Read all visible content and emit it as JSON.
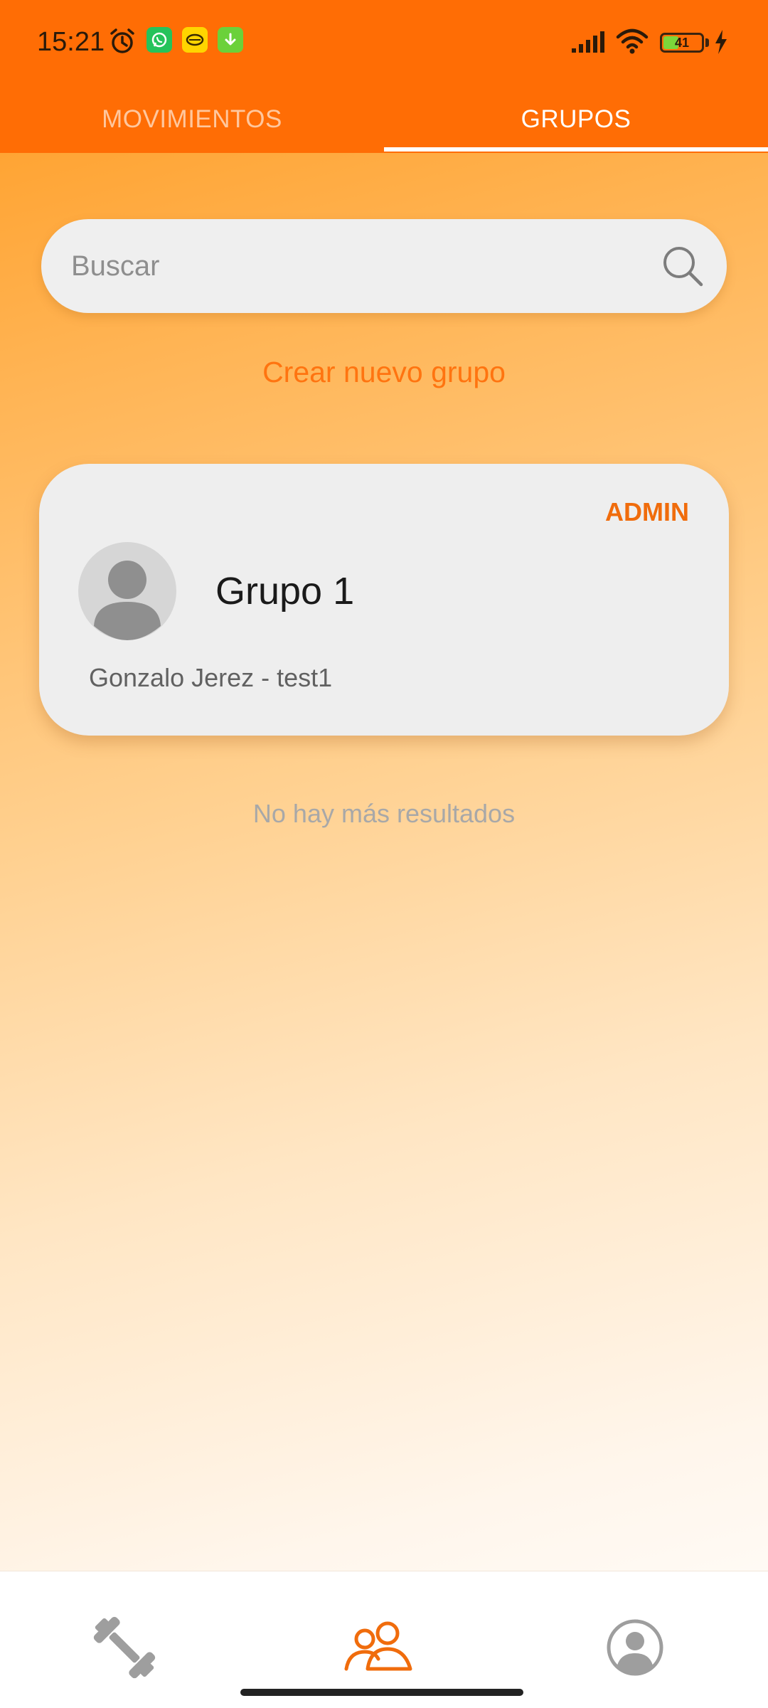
{
  "status_bar": {
    "time": "15:21",
    "battery_level": "41",
    "battery_fraction": 0.41,
    "icons": [
      "alarm-icon",
      "whatsapp-icon",
      "lemon-icon",
      "download-icon",
      "signal-icon",
      "wifi-icon",
      "battery-icon",
      "charging-bolt-icon"
    ]
  },
  "tabs": [
    {
      "label": "MOVIMIENTOS",
      "selected": false
    },
    {
      "label": "GRUPOS",
      "selected": true
    }
  ],
  "search": {
    "placeholder": "Buscar",
    "value": ""
  },
  "create_group_label": "Crear nuevo grupo",
  "groups": [
    {
      "name": "Grupo 1",
      "role": "ADMIN",
      "members": "Gonzalo Jerez - test1",
      "avatar_icon": "person-avatar-icon"
    }
  ],
  "no_more_results": "No hay más resultados",
  "bottom_nav": {
    "items": [
      {
        "icon": "dumbbell-icon",
        "active": false
      },
      {
        "icon": "groups-icon",
        "active": true
      },
      {
        "icon": "profile-icon",
        "active": false
      }
    ]
  },
  "colors": {
    "header": "#ff6d05",
    "accent": "#ff7410",
    "admin": "#f06c0c",
    "card": "#eeeeee",
    "inactive_icon": "#9e9e9e"
  }
}
